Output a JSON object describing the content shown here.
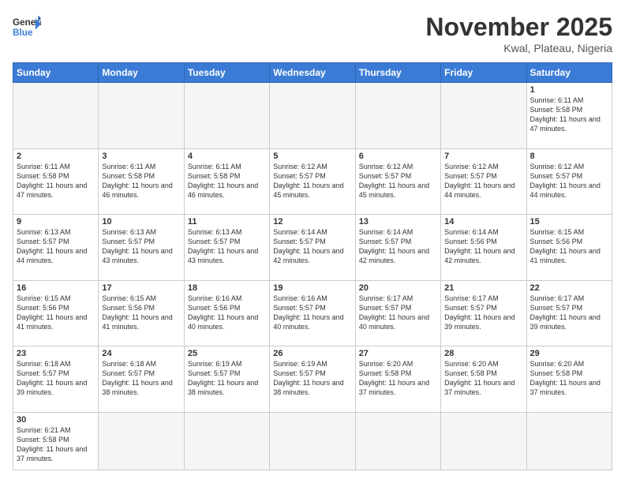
{
  "header": {
    "logo_general": "General",
    "logo_blue": "Blue",
    "month_title": "November 2025",
    "location": "Kwal, Plateau, Nigeria"
  },
  "days_of_week": [
    "Sunday",
    "Monday",
    "Tuesday",
    "Wednesday",
    "Thursday",
    "Friday",
    "Saturday"
  ],
  "weeks": [
    [
      {
        "day": "",
        "info": ""
      },
      {
        "day": "",
        "info": ""
      },
      {
        "day": "",
        "info": ""
      },
      {
        "day": "",
        "info": ""
      },
      {
        "day": "",
        "info": ""
      },
      {
        "day": "",
        "info": ""
      },
      {
        "day": "1",
        "info": "Sunrise: 6:11 AM\nSunset: 5:58 PM\nDaylight: 11 hours and 47 minutes."
      }
    ],
    [
      {
        "day": "2",
        "info": "Sunrise: 6:11 AM\nSunset: 5:58 PM\nDaylight: 11 hours and 47 minutes."
      },
      {
        "day": "3",
        "info": "Sunrise: 6:11 AM\nSunset: 5:58 PM\nDaylight: 11 hours and 46 minutes."
      },
      {
        "day": "4",
        "info": "Sunrise: 6:11 AM\nSunset: 5:58 PM\nDaylight: 11 hours and 46 minutes."
      },
      {
        "day": "5",
        "info": "Sunrise: 6:12 AM\nSunset: 5:57 PM\nDaylight: 11 hours and 45 minutes."
      },
      {
        "day": "6",
        "info": "Sunrise: 6:12 AM\nSunset: 5:57 PM\nDaylight: 11 hours and 45 minutes."
      },
      {
        "day": "7",
        "info": "Sunrise: 6:12 AM\nSunset: 5:57 PM\nDaylight: 11 hours and 44 minutes."
      },
      {
        "day": "8",
        "info": "Sunrise: 6:12 AM\nSunset: 5:57 PM\nDaylight: 11 hours and 44 minutes."
      }
    ],
    [
      {
        "day": "9",
        "info": "Sunrise: 6:13 AM\nSunset: 5:57 PM\nDaylight: 11 hours and 44 minutes."
      },
      {
        "day": "10",
        "info": "Sunrise: 6:13 AM\nSunset: 5:57 PM\nDaylight: 11 hours and 43 minutes."
      },
      {
        "day": "11",
        "info": "Sunrise: 6:13 AM\nSunset: 5:57 PM\nDaylight: 11 hours and 43 minutes."
      },
      {
        "day": "12",
        "info": "Sunrise: 6:14 AM\nSunset: 5:57 PM\nDaylight: 11 hours and 42 minutes."
      },
      {
        "day": "13",
        "info": "Sunrise: 6:14 AM\nSunset: 5:57 PM\nDaylight: 11 hours and 42 minutes."
      },
      {
        "day": "14",
        "info": "Sunrise: 6:14 AM\nSunset: 5:56 PM\nDaylight: 11 hours and 42 minutes."
      },
      {
        "day": "15",
        "info": "Sunrise: 6:15 AM\nSunset: 5:56 PM\nDaylight: 11 hours and 41 minutes."
      }
    ],
    [
      {
        "day": "16",
        "info": "Sunrise: 6:15 AM\nSunset: 5:56 PM\nDaylight: 11 hours and 41 minutes."
      },
      {
        "day": "17",
        "info": "Sunrise: 6:15 AM\nSunset: 5:56 PM\nDaylight: 11 hours and 41 minutes."
      },
      {
        "day": "18",
        "info": "Sunrise: 6:16 AM\nSunset: 5:56 PM\nDaylight: 11 hours and 40 minutes."
      },
      {
        "day": "19",
        "info": "Sunrise: 6:16 AM\nSunset: 5:57 PM\nDaylight: 11 hours and 40 minutes."
      },
      {
        "day": "20",
        "info": "Sunrise: 6:17 AM\nSunset: 5:57 PM\nDaylight: 11 hours and 40 minutes."
      },
      {
        "day": "21",
        "info": "Sunrise: 6:17 AM\nSunset: 5:57 PM\nDaylight: 11 hours and 39 minutes."
      },
      {
        "day": "22",
        "info": "Sunrise: 6:17 AM\nSunset: 5:57 PM\nDaylight: 11 hours and 39 minutes."
      }
    ],
    [
      {
        "day": "23",
        "info": "Sunrise: 6:18 AM\nSunset: 5:57 PM\nDaylight: 11 hours and 39 minutes."
      },
      {
        "day": "24",
        "info": "Sunrise: 6:18 AM\nSunset: 5:57 PM\nDaylight: 11 hours and 38 minutes."
      },
      {
        "day": "25",
        "info": "Sunrise: 6:19 AM\nSunset: 5:57 PM\nDaylight: 11 hours and 38 minutes."
      },
      {
        "day": "26",
        "info": "Sunrise: 6:19 AM\nSunset: 5:57 PM\nDaylight: 11 hours and 38 minutes."
      },
      {
        "day": "27",
        "info": "Sunrise: 6:20 AM\nSunset: 5:58 PM\nDaylight: 11 hours and 37 minutes."
      },
      {
        "day": "28",
        "info": "Sunrise: 6:20 AM\nSunset: 5:58 PM\nDaylight: 11 hours and 37 minutes."
      },
      {
        "day": "29",
        "info": "Sunrise: 6:20 AM\nSunset: 5:58 PM\nDaylight: 11 hours and 37 minutes."
      }
    ],
    [
      {
        "day": "30",
        "info": "Sunrise: 6:21 AM\nSunset: 5:58 PM\nDaylight: 11 hours and 37 minutes."
      },
      {
        "day": "",
        "info": ""
      },
      {
        "day": "",
        "info": ""
      },
      {
        "day": "",
        "info": ""
      },
      {
        "day": "",
        "info": ""
      },
      {
        "day": "",
        "info": ""
      },
      {
        "day": "",
        "info": ""
      }
    ]
  ]
}
